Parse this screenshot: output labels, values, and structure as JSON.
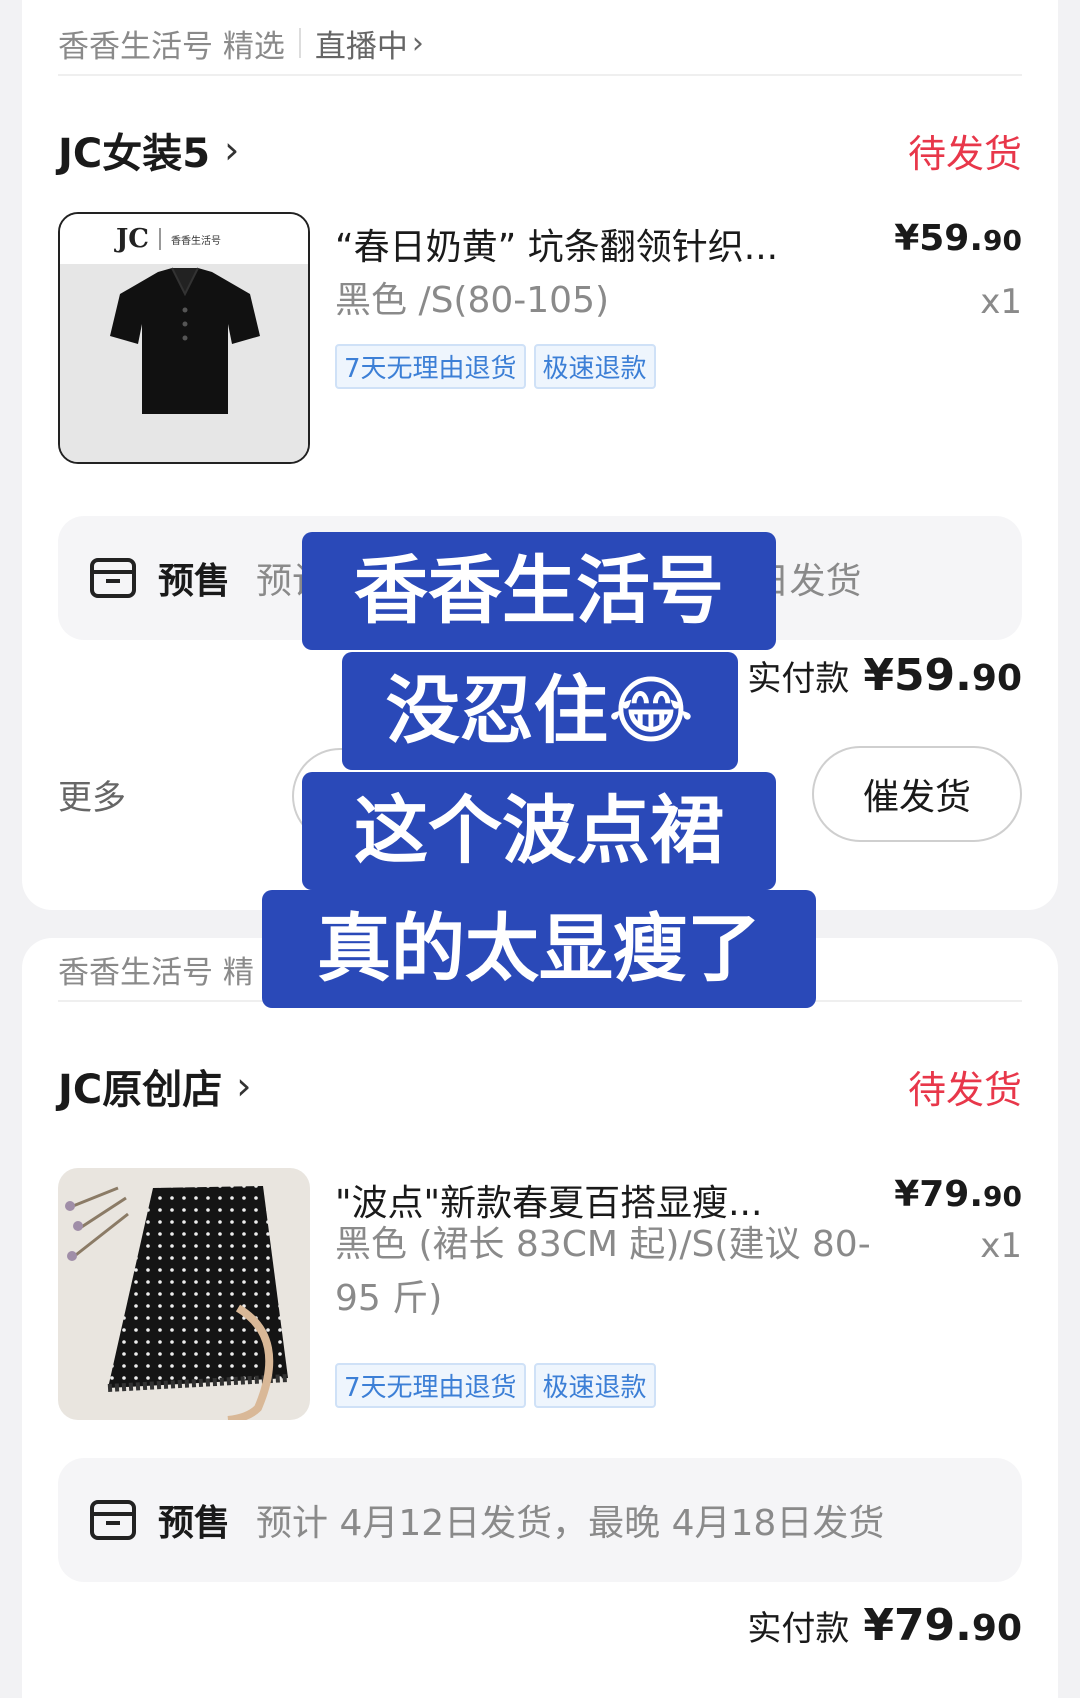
{
  "orders": [
    {
      "source": "香香生活号 精选",
      "live": "直播中",
      "shop": "JC女装5",
      "status": "待发货",
      "product_title": "“春日奶黄” 坑条翻领针织...",
      "price": "¥59.90",
      "price_main": "¥59.",
      "price_dec": "90",
      "spec": "黑色 /S(80-105)",
      "qty": "x1",
      "tags": [
        "7天无理由退货",
        "极速退款"
      ],
      "presale_label": "预售",
      "presale_text": "预计4月12日发货，最晚4月18日发货",
      "presale_visible_left": "预",
      "presale_visible_right": "18日发货",
      "paid_label": "实付款",
      "paid_main": "¥59.",
      "paid_dec": "90",
      "more": "更多",
      "urge_button": "催发货",
      "thumb_brand": "JC",
      "thumb_caption": "香香生活号"
    },
    {
      "source": "香香生活号 精",
      "shop": "JC原创店",
      "status": "待发货",
      "product_title": "\"波点\"新款春夏百搭显瘦...",
      "price_main": "¥79.",
      "price_dec": "90",
      "spec": "黑色 (裙长 83CM 起)/S(建议 80-95 斤)",
      "qty": "x1",
      "tags": [
        "7天无理由退货",
        "极速退款"
      ],
      "presale_label": "预售",
      "presale_text": "预计 4月12日发货，最晚 4月18日发货",
      "paid_label": "实付款",
      "paid_main": "¥79.",
      "paid_dec": "90"
    }
  ],
  "overlay": {
    "lines": [
      "香香生活号",
      "没忍住😂",
      "这个波点裙",
      "真的太显瘦了"
    ],
    "color": "#2a49b8"
  },
  "colors": {
    "status": "#e8374a",
    "tag_text": "#3c7fd6",
    "background": "#f2f2f4"
  }
}
